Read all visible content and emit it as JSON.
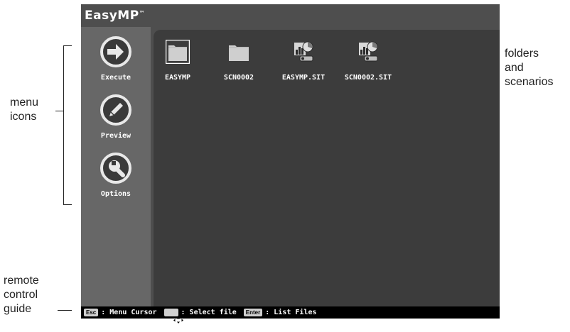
{
  "annotations": {
    "menu_icons": "menu\nicons",
    "folders_and_scenarios": "folders\nand\nscenarios",
    "remote_control_guide": "remote\ncontrol\nguide"
  },
  "app": {
    "brand": "EasyMP",
    "trademark": "™"
  },
  "sidebar": {
    "items": [
      {
        "label": "Execute",
        "icon": "arrow-right-circle-icon"
      },
      {
        "label": "Preview",
        "icon": "pencil-circle-icon"
      },
      {
        "label": "Options",
        "icon": "wrench-circle-icon"
      }
    ]
  },
  "files": [
    {
      "label": "EASYMP",
      "icon": "folder-selected-icon"
    },
    {
      "label": "SCN0002",
      "icon": "folder-icon"
    },
    {
      "label": "EASYMP.SIT",
      "icon": "scenario-icon"
    },
    {
      "label": "SCN0002.SIT",
      "icon": "scenario-icon"
    }
  ],
  "guide": {
    "esc_key": "Esc",
    "esc_text": ": Menu Cursor",
    "dpad_text": ": Select file",
    "enter_key": "Enter",
    "enter_text": ": List Files"
  },
  "colors": {
    "screen_bg": "#4e4e4e",
    "sidebar_bg": "#676767",
    "main_bg": "#3c3c3c",
    "guide_bg": "#000000"
  }
}
